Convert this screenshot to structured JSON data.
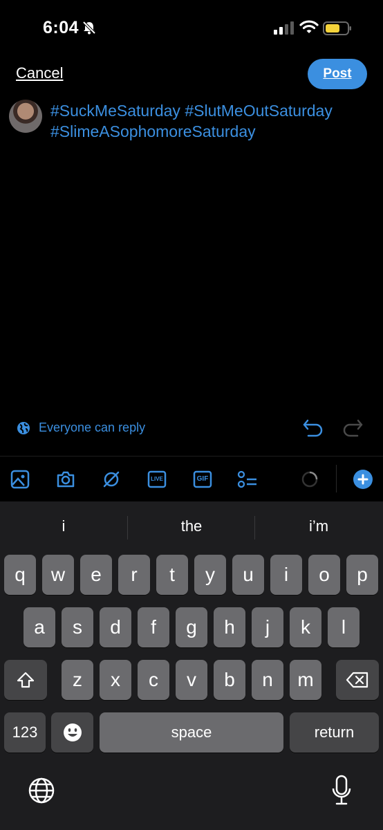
{
  "status_bar": {
    "time": "6:04"
  },
  "header": {
    "cancel_label": "Cancel",
    "post_label": "Post"
  },
  "compose": {
    "text_line1": "#SuckMeSaturday #SlutMeOutSaturday",
    "text_line2": "#SlimeASophomoreSaturday"
  },
  "reply_setting": {
    "label": "Everyone can reply"
  },
  "toolbar": {
    "icons": [
      "image-icon",
      "camera-icon",
      "spaces-icon",
      "live-icon",
      "gif-icon",
      "poll-icon"
    ],
    "live_label": "LIVE",
    "gif_label": "GIF"
  },
  "keyboard": {
    "suggestions": [
      "i",
      "the",
      "i’m"
    ],
    "row1": [
      "q",
      "w",
      "e",
      "r",
      "t",
      "y",
      "u",
      "i",
      "o",
      "p"
    ],
    "row2": [
      "a",
      "s",
      "d",
      "f",
      "g",
      "h",
      "j",
      "k",
      "l"
    ],
    "row3": [
      "z",
      "x",
      "c",
      "v",
      "b",
      "n",
      "m"
    ],
    "numbers_label": "123",
    "space_label": "space",
    "return_label": "return"
  },
  "colors": {
    "accent": "#3b8fe0",
    "background": "#000000",
    "keyboard_bg": "#1d1d1f",
    "battery": "#f5d33a"
  }
}
